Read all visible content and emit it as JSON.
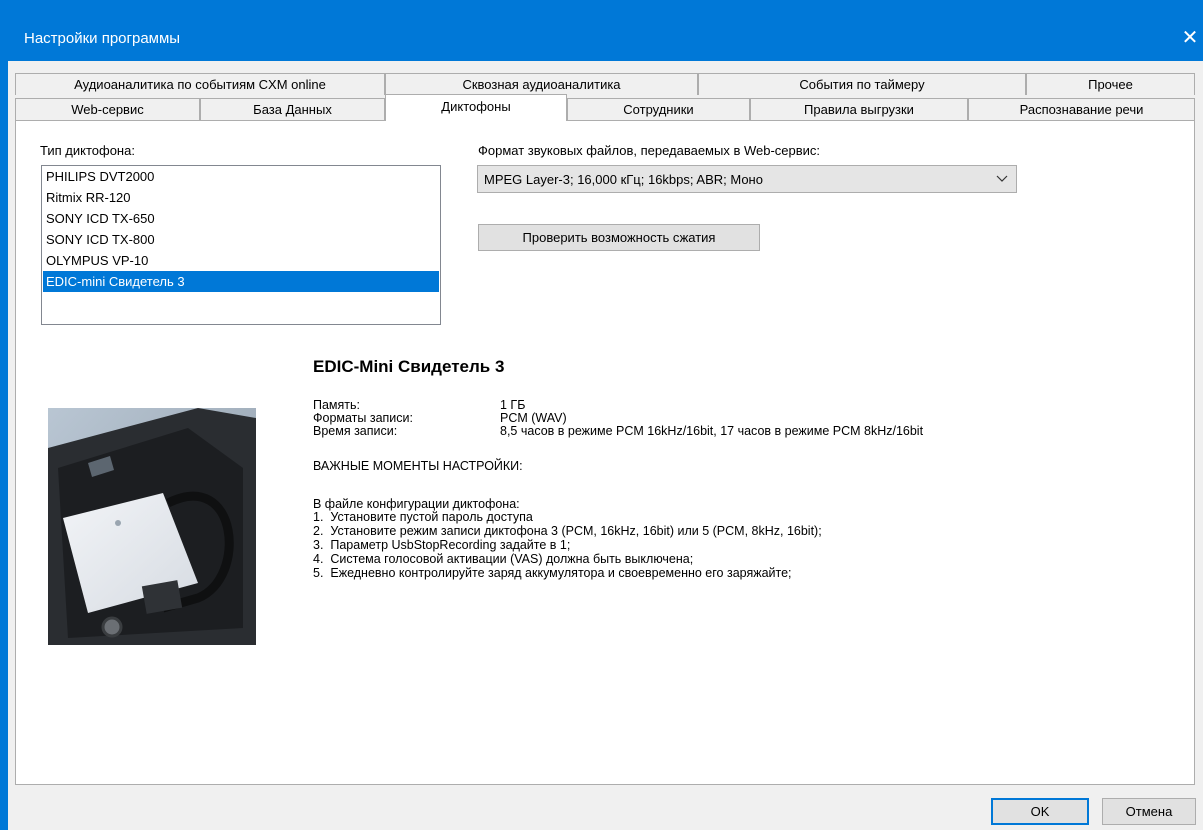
{
  "window": {
    "title": "Настройки программы",
    "close_glyph": "✕"
  },
  "tabs_row1": [
    "Аудиоаналитика по событиям CXM online",
    "Сквозная аудиоаналитика",
    "События по таймеру",
    "Прочее"
  ],
  "tabs_row2": [
    "Web-сервис",
    "База Данных",
    "Диктофоны",
    "Сотрудники",
    "Правила выгрузки",
    "Распознавание речи"
  ],
  "active_tab": "Диктофоны",
  "recorder": {
    "type_label": "Тип диктофона:",
    "items": [
      "PHILIPS DVT2000",
      "Ritmix RR-120",
      "SONY ICD TX-650",
      "SONY ICD TX-800",
      "OLYMPUS VP-10",
      "EDIC-mini Свидетель 3"
    ],
    "selected": "EDIC-mini Свидетель 3"
  },
  "format": {
    "label": "Формат звуковых файлов, передаваемых в Web-сервис:",
    "value": "MPEG Layer-3; 16,000 кГц; 16kbps; ABR; Моно",
    "check_button": "Проверить возможность сжатия"
  },
  "device_info": {
    "name": "EDIC-Mini Свидетель 3",
    "memory_label": "Память:",
    "memory_value": "1 ГБ",
    "formats_label": "Форматы записи:",
    "formats_value": "PCM (WAV)",
    "time_label": "Время записи:",
    "time_value": "8,5 часов в режиме PCM 16kHz/16bit, 17 часов в режиме PCM 8kHz/16bit",
    "important": "ВАЖНЫЕ МОМЕНТЫ НАСТРОЙКИ:",
    "config_intro": "В файле конфигурации диктофона:",
    "steps": [
      "1.  Установите пустой пароль доступа",
      "2.  Установите режим записи диктофона 3 (PCM, 16kHz, 16bit) или 5 (PCM, 8kHz, 16bit);",
      "3.  Параметр UsbStopRecording задайте в 1;",
      "4.  Система голосовой активации (VAS) должна быть выключена;",
      "5.  Ежедневно контролируйте заряд аккумулятора и своевременно его заряжайте;"
    ]
  },
  "footer": {
    "ok": "OK",
    "cancel": "Отмена"
  },
  "colors": {
    "titlebar": "#0078d7",
    "selection": "#0078d7",
    "dialog_bg": "#f0f0f0"
  },
  "icons": {
    "close": "close-icon",
    "dropdown": "chevron-down-icon"
  }
}
